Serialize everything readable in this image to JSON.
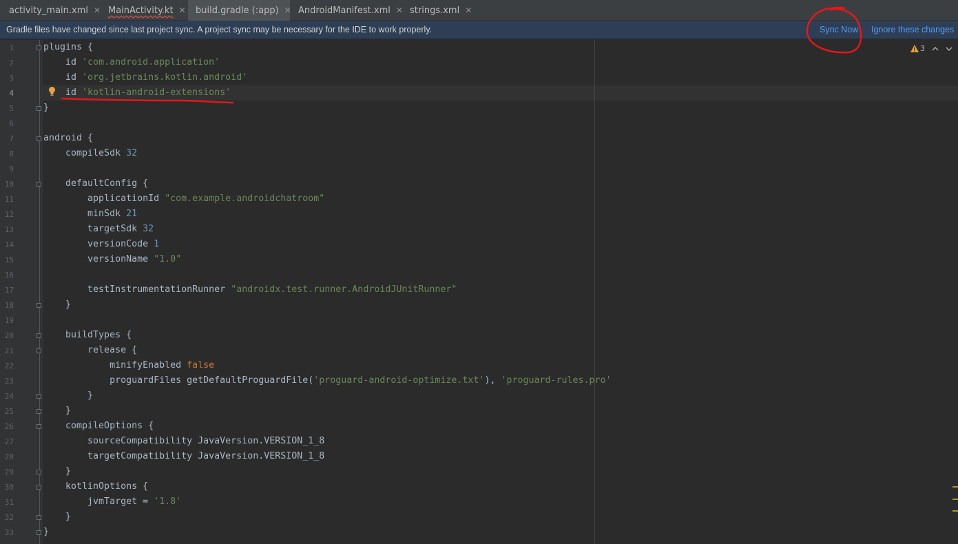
{
  "tabs": [
    {
      "label": "activity_main.xml",
      "icon": "xml-file-icon",
      "active": false,
      "error": false
    },
    {
      "label": "MainActivity.kt",
      "icon": "kotlin-class-icon",
      "active": false,
      "error": true
    },
    {
      "label": "build.gradle (:app)",
      "icon": "gradle-elephant-icon",
      "active": true,
      "error": false
    },
    {
      "label": "AndroidManifest.xml",
      "icon": "manifest-file-icon",
      "active": false,
      "error": false
    },
    {
      "label": "strings.xml",
      "icon": "xml-file-icon",
      "active": false,
      "error": false
    }
  ],
  "close_glyph": "✕",
  "notification": {
    "message": "Gradle files have changed since last project sync. A project sync may be necessary for the IDE to work properly.",
    "sync_now": "Sync Now",
    "ignore": "Ignore these changes"
  },
  "inspections": {
    "icon": "warning-icon",
    "warning_count": "3"
  },
  "editor": {
    "lines": [
      [
        [
          "t",
          "plugins {"
        ]
      ],
      [
        [
          "t",
          "    id "
        ],
        [
          "s",
          "'com.android.application'"
        ]
      ],
      [
        [
          "t",
          "    id "
        ],
        [
          "s",
          "'org.jetbrains.kotlin.android'"
        ]
      ],
      [
        [
          "t",
          "    id "
        ],
        [
          "s",
          "'kotlin-android-extensions'"
        ]
      ],
      [
        [
          "t",
          "}"
        ]
      ],
      [
        [
          "t",
          ""
        ]
      ],
      [
        [
          "t",
          "android {"
        ]
      ],
      [
        [
          "t",
          "    compileSdk "
        ],
        [
          "n",
          "32"
        ]
      ],
      [
        [
          "t",
          ""
        ]
      ],
      [
        [
          "t",
          "    defaultConfig {"
        ]
      ],
      [
        [
          "t",
          "        applicationId "
        ],
        [
          "s",
          "\"com.example.androidchatroom\""
        ]
      ],
      [
        [
          "t",
          "        minSdk "
        ],
        [
          "n",
          "21"
        ]
      ],
      [
        [
          "t",
          "        targetSdk "
        ],
        [
          "n",
          "32"
        ]
      ],
      [
        [
          "t",
          "        versionCode "
        ],
        [
          "n",
          "1"
        ]
      ],
      [
        [
          "t",
          "        versionName "
        ],
        [
          "s",
          "\"1.0\""
        ]
      ],
      [
        [
          "t",
          ""
        ]
      ],
      [
        [
          "t",
          "        testInstrumentationRunner "
        ],
        [
          "s",
          "\"androidx.test.runner.AndroidJUnitRunner\""
        ]
      ],
      [
        [
          "t",
          "    }"
        ]
      ],
      [
        [
          "t",
          ""
        ]
      ],
      [
        [
          "t",
          "    buildTypes {"
        ]
      ],
      [
        [
          "t",
          "        release {"
        ]
      ],
      [
        [
          "t",
          "            minifyEnabled "
        ],
        [
          "k",
          "false"
        ]
      ],
      [
        [
          "t",
          "            proguardFiles getDefaultProguardFile("
        ],
        [
          "s",
          "'proguard-android-optimize.txt'"
        ],
        [
          "t",
          "), "
        ],
        [
          "s",
          "'proguard-rules.pro'"
        ]
      ],
      [
        [
          "t",
          "        }"
        ]
      ],
      [
        [
          "t",
          "    }"
        ]
      ],
      [
        [
          "t",
          "    compileOptions {"
        ]
      ],
      [
        [
          "t",
          "        sourceCompatibility JavaVersion.VERSION_1_8"
        ]
      ],
      [
        [
          "t",
          "        targetCompatibility JavaVersion.VERSION_1_8"
        ]
      ],
      [
        [
          "t",
          "    }"
        ]
      ],
      [
        [
          "t",
          "    kotlinOptions {"
        ]
      ],
      [
        [
          "t",
          "        jvmTarget = "
        ],
        [
          "s",
          "'1.8'"
        ]
      ],
      [
        [
          "t",
          "    }"
        ]
      ],
      [
        [
          "t",
          "}"
        ]
      ]
    ],
    "current_line": 4
  },
  "colors": {
    "background": "#2b2b2b",
    "string": "#6a8759",
    "number": "#6897bb",
    "keyword": "#cc7832",
    "link": "#589df6",
    "annotation": "#e8161b"
  }
}
